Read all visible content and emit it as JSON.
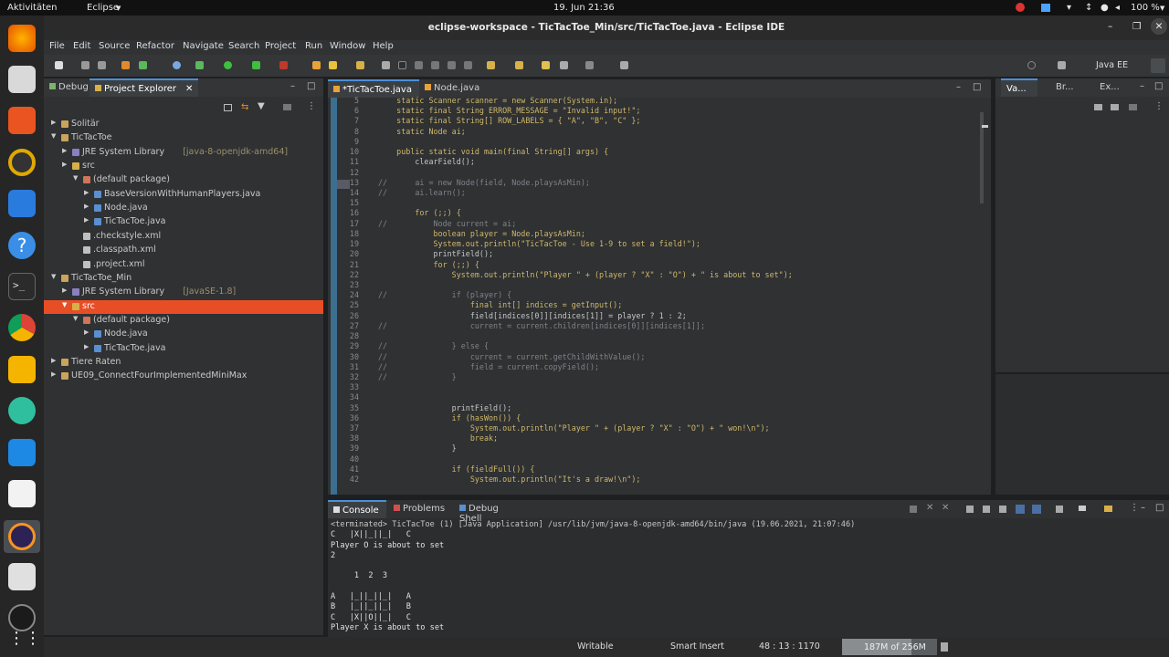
{
  "topbar": {
    "activities": "Aktivitäten",
    "app": "Eclipse",
    "clock": "19. Jun  21:36",
    "battery": "100 %"
  },
  "window": {
    "title": "eclipse-workspace - TicTacToe_Min/src/TicTacToe.java - Eclipse IDE"
  },
  "menu": [
    "File",
    "Edit",
    "Source",
    "Refactor",
    "Navigate",
    "Search",
    "Project",
    "Run",
    "Window",
    "Help"
  ],
  "perspective": "Java EE",
  "left_tabs": [
    "Debug",
    "Project Explorer"
  ],
  "tree": [
    {
      "label": "Solitär",
      "depth": 0,
      "type": "project",
      "open": false
    },
    {
      "label": "TicTacToe",
      "depth": 0,
      "type": "project",
      "open": true
    },
    {
      "label": "JRE System Library",
      "extra": "[java-8-openjdk-amd64]",
      "depth": 1,
      "type": "lib",
      "open": false
    },
    {
      "label": "src",
      "depth": 1,
      "type": "folder",
      "open": false
    },
    {
      "label": "(default package)",
      "depth": 2,
      "type": "package",
      "open": true
    },
    {
      "label": "BaseVersionWithHumanPlayers.java",
      "depth": 3,
      "type": "java",
      "open": false
    },
    {
      "label": "Node.java",
      "depth": 3,
      "type": "java",
      "open": false
    },
    {
      "label": "TicTacToe.java",
      "depth": 3,
      "type": "java",
      "open": false
    },
    {
      "label": ".checkstyle.xml",
      "depth": 2,
      "type": "xml",
      "leaf": true
    },
    {
      "label": ".classpath.xml",
      "depth": 2,
      "type": "xml",
      "leaf": true
    },
    {
      "label": ".project.xml",
      "depth": 2,
      "type": "xml",
      "leaf": true
    },
    {
      "label": "TicTacToe_Min",
      "depth": 0,
      "type": "project",
      "open": true
    },
    {
      "label": "JRE System Library",
      "extra": "[JavaSE-1.8]",
      "depth": 1,
      "type": "lib",
      "open": false
    },
    {
      "label": "src",
      "depth": 1,
      "type": "folder",
      "open": true,
      "selected": true
    },
    {
      "label": "(default package)",
      "depth": 2,
      "type": "package",
      "open": true
    },
    {
      "label": "Node.java",
      "depth": 3,
      "type": "java",
      "open": false
    },
    {
      "label": "TicTacToe.java",
      "depth": 3,
      "type": "java",
      "open": false
    },
    {
      "label": "Tiere Raten",
      "depth": 0,
      "type": "project",
      "open": false
    },
    {
      "label": "UE09_ConnectFourImplementedMiniMax",
      "depth": 0,
      "type": "project",
      "open": false
    }
  ],
  "editor_tabs": [
    "*TicTacToe.java",
    "Node.java"
  ],
  "code": [
    {
      "n": "5",
      "t": "    static Scanner scanner = new Scanner(System.in);"
    },
    {
      "n": "6",
      "t": "    static final String ERROR_MESSAGE = \"Invalid input!\";"
    },
    {
      "n": "7",
      "t": "    static final String[] ROW_LABELS = { \"A\", \"B\", \"C\" };"
    },
    {
      "n": "8",
      "t": "    static Node ai;"
    },
    {
      "n": "9",
      "t": ""
    },
    {
      "n": "10",
      "t": "    public static void main(final String[] args) {"
    },
    {
      "n": "11",
      "t": "        clearField();"
    },
    {
      "n": "12",
      "t": ""
    },
    {
      "n": "13",
      "t": "//      ai = new Node(field, Node.playsAsMin);"
    },
    {
      "n": "14",
      "t": "//      ai.learn();"
    },
    {
      "n": "15",
      "t": ""
    },
    {
      "n": "16",
      "t": "        for (;;) {"
    },
    {
      "n": "17",
      "t": "//          Node current = ai;"
    },
    {
      "n": "18",
      "t": "            boolean player = Node.playsAsMin;"
    },
    {
      "n": "19",
      "t": "            System.out.println(\"TicTacToe - Use 1-9 to set a field!\");"
    },
    {
      "n": "20",
      "t": "            printField();"
    },
    {
      "n": "21",
      "t": "            for (;;) {"
    },
    {
      "n": "22",
      "t": "                System.out.println(\"Player \" + (player ? \"X\" : \"O\") + \" is about to set\");"
    },
    {
      "n": "23",
      "t": ""
    },
    {
      "n": "24",
      "t": "//              if (player) {"
    },
    {
      "n": "25",
      "t": "                    final int[] indices = getInput();"
    },
    {
      "n": "26",
      "t": "                    field[indices[0]][indices[1]] = player ? 1 : 2;"
    },
    {
      "n": "27",
      "t": "//                  current = current.children[indices[0]][indices[1]];"
    },
    {
      "n": "28",
      "t": ""
    },
    {
      "n": "29",
      "t": "//              } else {"
    },
    {
      "n": "30",
      "t": "//                  current = current.getChildWithValue();"
    },
    {
      "n": "31",
      "t": "//                  field = current.copyField();"
    },
    {
      "n": "32",
      "t": "//              }"
    },
    {
      "n": "33",
      "t": ""
    },
    {
      "n": "34",
      "t": ""
    },
    {
      "n": "35",
      "t": "                printField();"
    },
    {
      "n": "36",
      "t": "                if (hasWon()) {"
    },
    {
      "n": "37",
      "t": "                    System.out.println(\"Player \" + (player ? \"X\" : \"O\") + \" won!\\n\");"
    },
    {
      "n": "38",
      "t": "                    break;"
    },
    {
      "n": "39",
      "t": "                }"
    },
    {
      "n": "40",
      "t": ""
    },
    {
      "n": "41",
      "t": "                if (fieldFull()) {"
    },
    {
      "n": "42",
      "t": "                    System.out.println(\"It's a draw!\\n\");"
    }
  ],
  "right_tabs": [
    "Va...",
    "Br...",
    "Ex..."
  ],
  "console_tabs": [
    "Console",
    "Problems",
    "Debug Shell"
  ],
  "console_lines": [
    "<terminated> TicTacToe (1) [Java Application] /usr/lib/jvm/java-8-openjdk-amd64/bin/java (19.06.2021, 21:07:46)",
    "C   |X||_||_|   C",
    "Player O is about to set",
    "2",
    "",
    "     1  2  3",
    "",
    "A   |_||_||_|   A",
    "B   |_||_||_|   B",
    "C   |X||O||_|   C",
    "Player X is about to set"
  ],
  "status": {
    "writable": "Writable",
    "insert": "Smart Insert",
    "position": "48 : 13 : 1170",
    "memory": "187M of 256M"
  },
  "colors": {
    "selection": "#e84e25",
    "accent": "#4a90d9"
  }
}
